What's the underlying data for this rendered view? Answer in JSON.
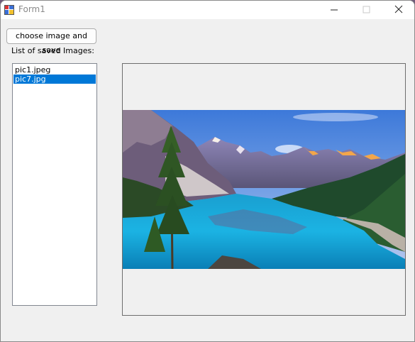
{
  "window": {
    "title": "Form1"
  },
  "toolbar": {
    "choose_label": "choose image and save"
  },
  "list": {
    "label": "List of saved Images:",
    "items": [
      {
        "name": "pic1.jpeg",
        "selected": false
      },
      {
        "name": "pic7.jpg",
        "selected": true
      }
    ]
  },
  "colors": {
    "selection": "#0078d7",
    "window_bg": "#f0f0f0"
  },
  "picture": {
    "subject": "mountain lake landscape"
  }
}
